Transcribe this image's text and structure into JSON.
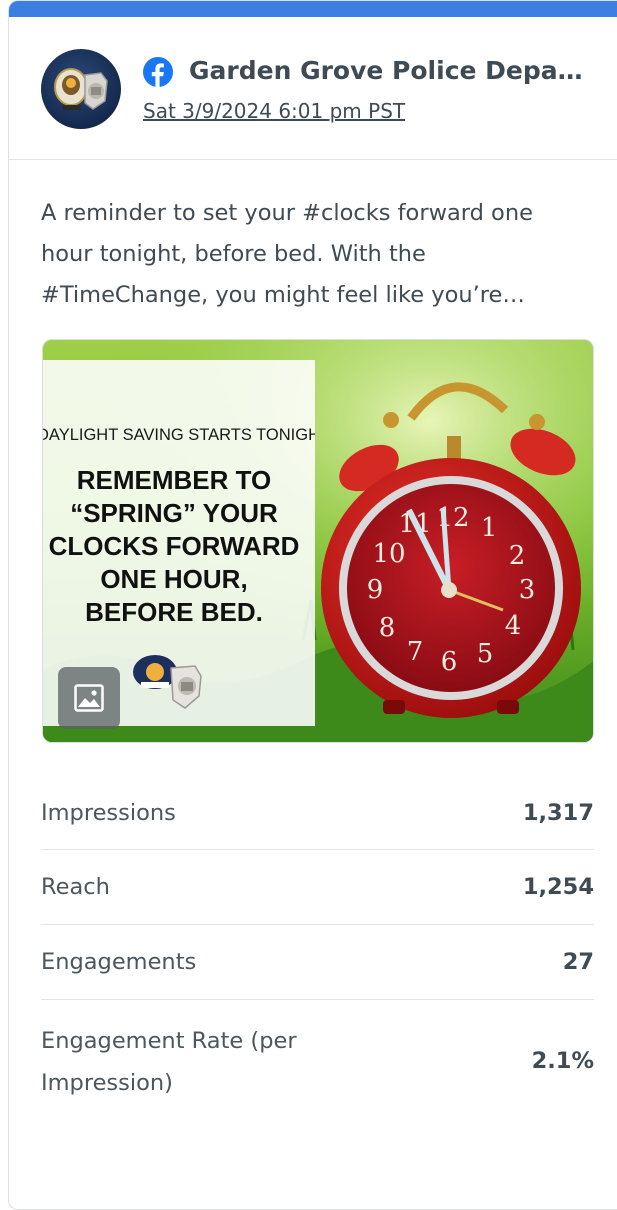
{
  "post": {
    "page_name": "Garden Grove Police Depa…",
    "date": "Sat 3/9/2024 6:01 pm PST",
    "text": "A reminder to set your #clocks forward one hour tonight, before bed. With the #TimeChange, you might feel like you’re…",
    "network_icon": "facebook-icon",
    "avatar_icon": "police-badge-logo"
  },
  "media": {
    "overlay_small": "DAYLIGHT SAVING STARTS TONIGHT",
    "overlay_big": "REMEMBER TO\n“SPRING” YOUR\nCLOCKS FORWARD\nONE HOUR,\nBEFORE BED.",
    "type_icon": "image-icon"
  },
  "metrics": [
    {
      "label": "Impressions",
      "value": "1,317"
    },
    {
      "label": "Reach",
      "value": "1,254"
    },
    {
      "label": "Engagements",
      "value": "27"
    },
    {
      "label": "Engagement Rate (per Impression)",
      "value": "2.1%"
    }
  ],
  "colors": {
    "accent_bar": "#3b7fe0",
    "facebook_blue": "#1877f2",
    "text": "#3f4b54",
    "divider": "#e3e6e9"
  }
}
